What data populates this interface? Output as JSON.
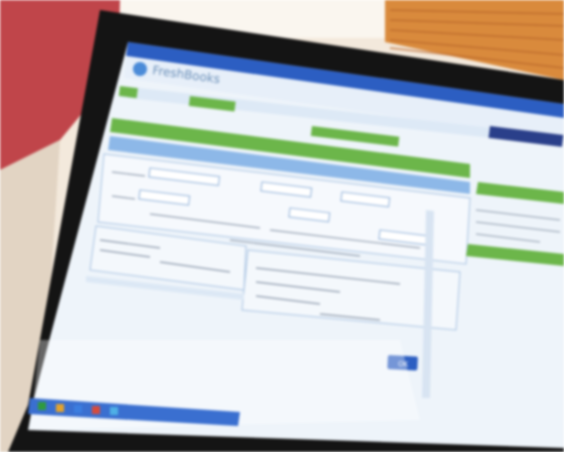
{
  "photo": {
    "subject": "monitor-showing-web-app",
    "colors": {
      "wall": "#f3e9dc",
      "red_panel": "#c0454a",
      "orange_blinds": "#d98a3c",
      "bezel": "#141414",
      "screen_bg": "#eef4fa",
      "chrome_blue": "#2c5ec2",
      "accent_green": "#6cb64a",
      "panel_blue": "#8db8e8",
      "taskbar": "#3a6fd0"
    }
  },
  "app": {
    "logo_text": "FreshBooks",
    "button_label": "OK"
  }
}
